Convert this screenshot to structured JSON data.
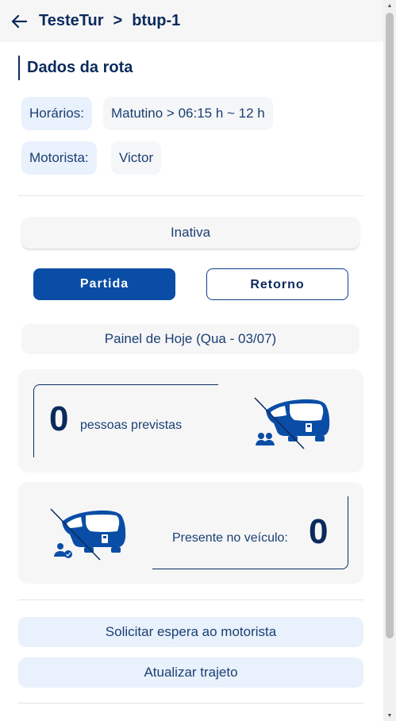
{
  "header": {
    "breadcrumb": [
      "TesteTur",
      "btup-1"
    ],
    "separator": ">"
  },
  "route": {
    "section_title": "Dados da rota",
    "schedule_label": "Horários:",
    "schedule_value": "Matutino > 06:15 h ~ 12 h",
    "driver_label": "Motorista:",
    "driver_value": "Victor"
  },
  "status": "Inativa",
  "direction_tabs": [
    {
      "label": "Partida",
      "active": true
    },
    {
      "label": "Retorno",
      "active": false
    }
  ],
  "panel": {
    "title": "Painel de Hoje (Qua - 03/07)",
    "expected_count": "0",
    "expected_label": "pessoas previstas",
    "present_label": "Presente no veículo:",
    "present_count": "0"
  },
  "actions": {
    "request_wait": "Solicitar espera ao motorista",
    "update_route": "Atualizar trajeto"
  },
  "colors": {
    "primary": "#0a4da6",
    "navy": "#0b2a5c",
    "chip_blue": "#e9f1fc",
    "card_bg": "#f6f6f7"
  }
}
